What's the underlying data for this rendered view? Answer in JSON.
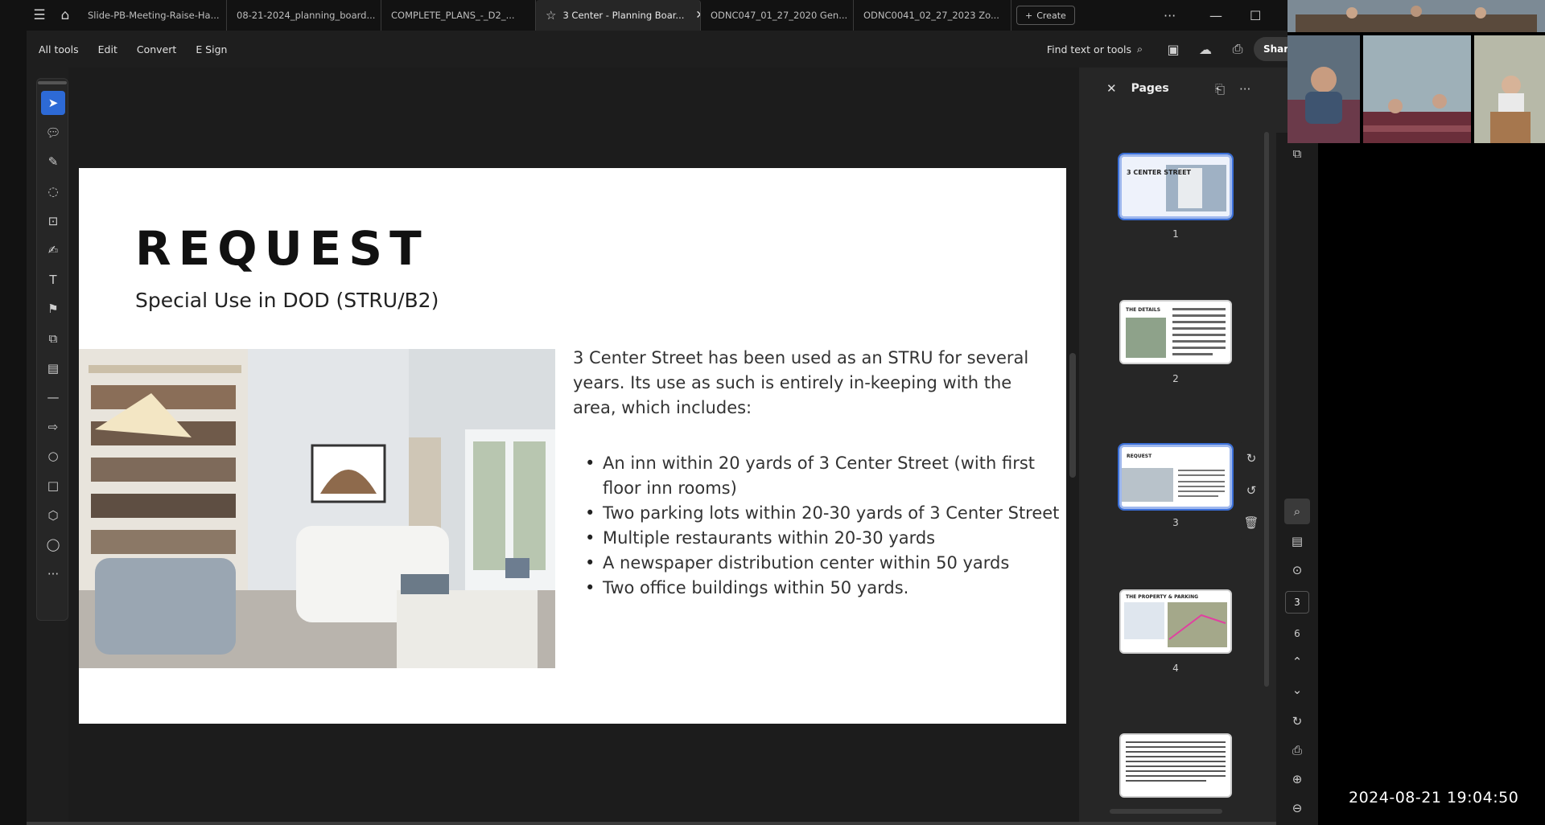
{
  "tabs": [
    {
      "label": "Slide-PB-Meeting-Raise-Ha..."
    },
    {
      "label": "08-21-2024_planning_board..."
    },
    {
      "label": "COMPLETE_PLANS_-_D2_..."
    },
    {
      "label": "3 Center - Planning Boar..."
    },
    {
      "label": "ODNC047_01_27_2020 Gen..."
    },
    {
      "label": "ODNC0041_02_27_2023 Zo..."
    }
  ],
  "create_label": "Create",
  "menu": {
    "all_tools": "All tools",
    "edit": "Edit",
    "convert": "Convert",
    "esign": "E Sign"
  },
  "find_label": "Find text or tools",
  "share_label": "Shar",
  "slide": {
    "title": "REQUEST",
    "subtitle": "Special Use in DOD (STRU/B2)",
    "intro": "3 Center Street has been used as an STRU for several years. Its use as such is entirely in-keeping with the area, which includes:",
    "bullets": [
      "An inn within 20 yards of 3 Center Street (with first floor inn rooms)",
      "Two parking lots within 20-30 yards of 3 Center Street",
      "Multiple restaurants within 20-30 yards",
      "A newspaper distribution center within 50 yards",
      "Two office buildings within 50 yards."
    ]
  },
  "pages_panel": {
    "title": "Pages",
    "page_numbers": [
      "1",
      "2",
      "3",
      "4"
    ],
    "thumb1_title": "3 CENTER STREET",
    "thumb2_title": "THE DETAILS",
    "thumb3_title": "REQUEST",
    "thumb4_title": "THE PROPERTY & PARKING",
    "current_page": "3",
    "total_pages": "6"
  },
  "timestamp": "2024-08-21  19:04:50",
  "colors": {
    "accent": "#2d6ad6",
    "background": "#1e1e1e",
    "page": "#ffffff"
  }
}
